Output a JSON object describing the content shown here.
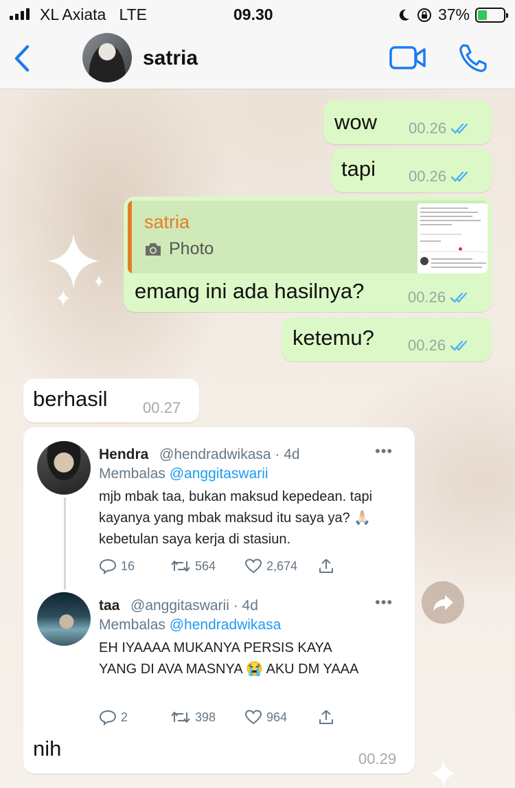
{
  "status_bar": {
    "carrier": "XL Axiata",
    "network": "LTE",
    "time": "09.30",
    "battery": "37%",
    "battery_level": 0.37,
    "icons": [
      "signal-icon",
      "moon-icon",
      "rotation-lock-icon",
      "battery-charging-icon"
    ]
  },
  "header": {
    "contact_name": "satria",
    "icons": [
      "back-chevron-icon",
      "video-call-icon",
      "phone-icon"
    ],
    "accent_color": "#1a7cf0"
  },
  "messages": [
    {
      "direction": "outgoing",
      "text": "wow",
      "time": "00.26",
      "status": "read"
    },
    {
      "direction": "outgoing",
      "text": "tapi",
      "time": "00.26",
      "status": "read"
    },
    {
      "direction": "outgoing",
      "reply_to": {
        "name": "satria",
        "type": "Photo"
      },
      "text": "emang ini ada hasilnya?",
      "time": "00.26",
      "status": "read"
    },
    {
      "direction": "outgoing",
      "text": "ketemu?",
      "time": "00.26",
      "status": "read"
    },
    {
      "direction": "incoming",
      "text": "berhasil",
      "time": "00.27"
    },
    {
      "direction": "incoming",
      "text": "nih",
      "time": "00.29",
      "tweet_screenshot": [
        {
          "name": "Hendra",
          "handle": "@hendradwikasa",
          "age": "· 4d",
          "reply_label": "Membalas",
          "reply_to": "@anggitaswarii",
          "text": "mjb mbak taa, bukan maksud kepedean. tapi kayanya yang mbak maksud itu saya ya? 🙏🏻 kebetulan saya kerja di stasiun.",
          "replies": "16",
          "retweets": "564",
          "likes": "2,674"
        },
        {
          "name": "taa",
          "handle": "@anggitaswarii",
          "age": "· 4d",
          "reply_label": "Membalas",
          "reply_to": "@hendradwikasa",
          "text": "EH IYAAAA MUKANYA PERSIS KAYA YANG DI AVA MASNYA 😭  AKU DM YAAA",
          "replies": "2",
          "retweets": "398",
          "likes": "964"
        }
      ]
    }
  ],
  "colors": {
    "outgoing_bubble": "#dcf8c6",
    "incoming_bubble": "#ffffff",
    "read_ticks": "#4fb3f0",
    "reply_name": "#e27d2a",
    "twitter_link": "#1d9bf0"
  }
}
